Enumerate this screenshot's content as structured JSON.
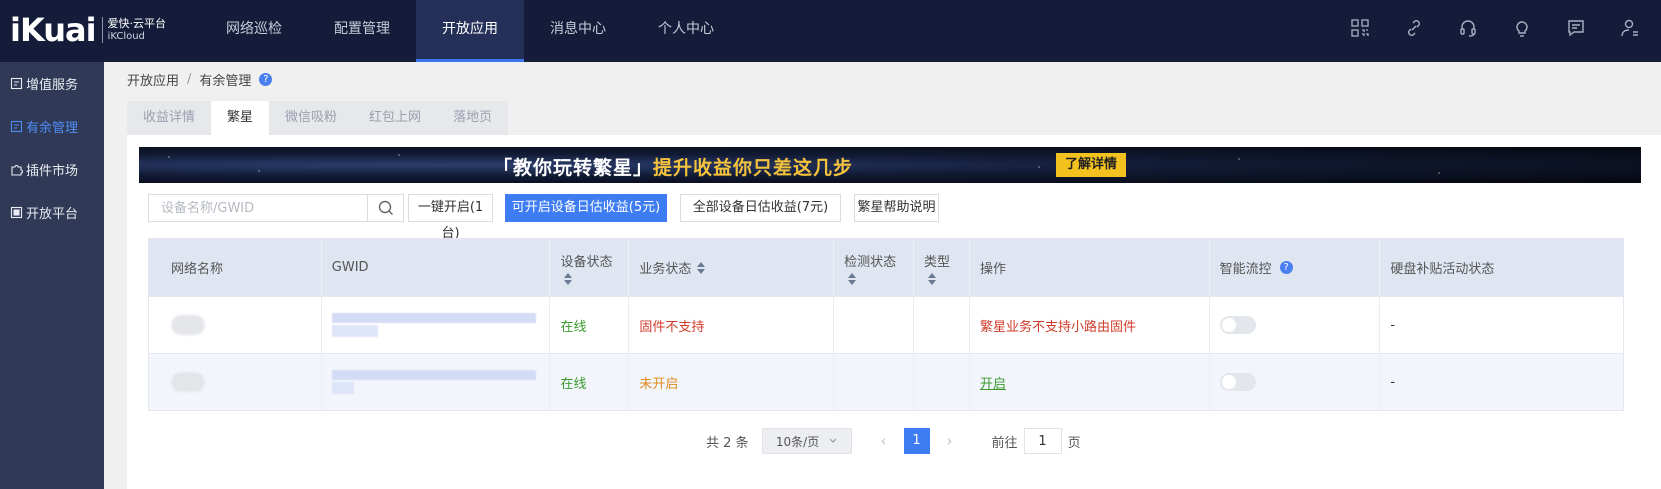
{
  "header": {
    "logo": "iKuai",
    "logo_line1": "爱快·云平台",
    "logo_line2": "iKCloud",
    "nav": [
      "网络巡检",
      "配置管理",
      "开放应用",
      "消息中心",
      "个人中心"
    ],
    "active_nav": "开放应用",
    "icons": [
      "qrcode-icon",
      "link-icon",
      "headset-icon",
      "lightbulb-icon",
      "message-icon",
      "user-settings-icon"
    ]
  },
  "sidebar": {
    "items": [
      {
        "label": "增值服务",
        "icon": "service-icon"
      },
      {
        "label": "有余管理",
        "icon": "manage-icon"
      },
      {
        "label": "插件市场",
        "icon": "plugin-icon"
      },
      {
        "label": "开放平台",
        "icon": "platform-icon"
      }
    ],
    "active": "有余管理"
  },
  "breadcrumb": {
    "root": "开放应用",
    "sep": "/",
    "current": "有余管理",
    "help": "?"
  },
  "tabs": [
    "收益详情",
    "繁星",
    "微信吸粉",
    "红包上网",
    "落地页"
  ],
  "active_tab": "繁星",
  "banner": {
    "text_white": "「教你玩转繁星」",
    "text_yellow": "提升收益你只差这几步",
    "button": "了解详情"
  },
  "toolbar": {
    "search_placeholder": "设备名称/GWID",
    "search_value": "",
    "btn_enable_all": "一键开启(1台)",
    "btn_enable_income": "可开启设备日估收益(5元)",
    "btn_all_income": "全部设备日估收益(7元)",
    "btn_help": "繁星帮助说明"
  },
  "table": {
    "columns": [
      "网络名称",
      "GWID",
      "设备状态",
      "业务状态",
      "检测状态",
      "类型",
      "操作",
      "智能流控",
      "硬盘补贴活动状态"
    ],
    "rows": [
      {
        "name": "",
        "gwid": "",
        "device_status": "在线",
        "business_status": "固件不支持",
        "detect_status": "",
        "type": "",
        "action": "繁星业务不支持小路由固件",
        "smart_flow": false,
        "disk_status": "-"
      },
      {
        "name": "",
        "gwid": "",
        "device_status": "在线",
        "business_status": "未开启",
        "detect_status": "",
        "type": "",
        "action": "开启",
        "smart_flow": false,
        "disk_status": "-"
      }
    ]
  },
  "pagination": {
    "total": "共 2 条",
    "page_size": "10条/页",
    "current_page": "1",
    "goto_label": "前往",
    "goto_value": "1",
    "page_suffix": "页"
  },
  "colors": {
    "topbar": "#141c39",
    "sidebar": "#303a56",
    "primary": "#3e7cf4",
    "green": "#3a9a2c",
    "red": "#d13a2a",
    "orange": "#e08a1c"
  }
}
